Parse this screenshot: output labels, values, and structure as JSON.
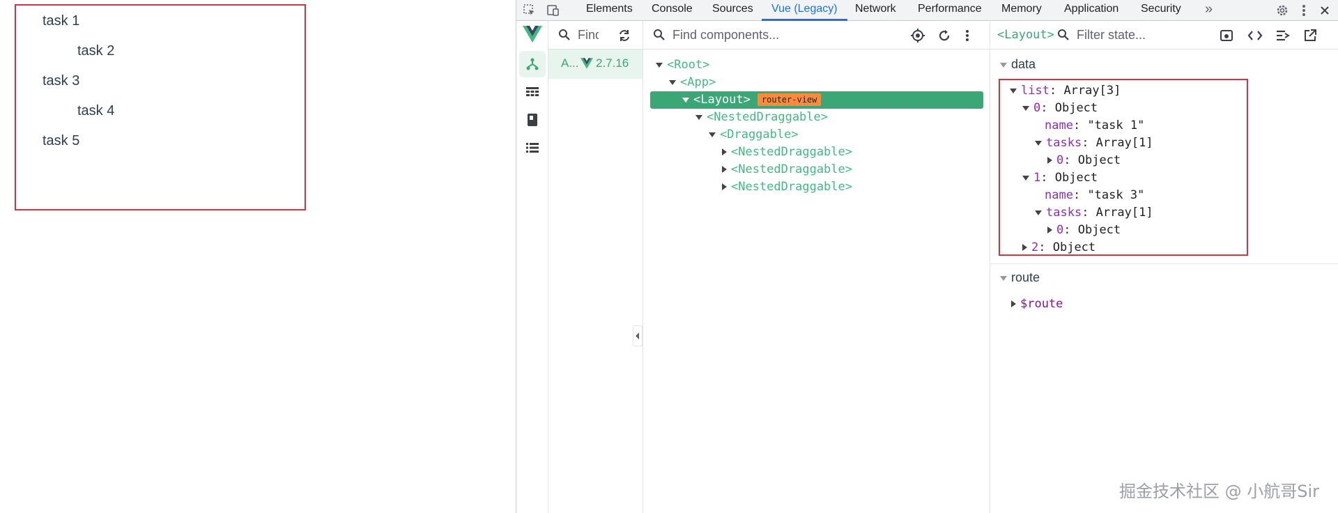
{
  "app": {
    "tasks": [
      "task 1",
      "task 2",
      "task 3",
      "task 4",
      "task 5"
    ]
  },
  "devtools": {
    "tabs": [
      "Elements",
      "Console",
      "Sources",
      "Vue (Legacy)",
      "Network",
      "Performance",
      "Memory",
      "Application",
      "Security"
    ],
    "active_tab": "Vue (Legacy)",
    "more_tabs": "»",
    "apps_search_placeholder": "Find apps...",
    "app_item": {
      "name": "A...",
      "version": "2.7.16"
    },
    "tree_search_placeholder": "Find components...",
    "tree": [
      {
        "label": "<Root>",
        "expanded": true,
        "depth": 0
      },
      {
        "label": "<App>",
        "expanded": true,
        "depth": 1
      },
      {
        "label": "<Layout>",
        "expanded": true,
        "depth": 2,
        "selected": true,
        "badge": "router-view"
      },
      {
        "label": "<NestedDraggable>",
        "expanded": true,
        "depth": 3
      },
      {
        "label": "<Draggable>",
        "expanded": true,
        "depth": 4
      },
      {
        "label": "<NestedDraggable>",
        "expanded": false,
        "depth": 5
      },
      {
        "label": "<NestedDraggable>",
        "expanded": false,
        "depth": 5
      },
      {
        "label": "<NestedDraggable>",
        "expanded": false,
        "depth": 5
      }
    ],
    "state": {
      "component": "<Layout>",
      "filter_placeholder": "Filter state...",
      "data_title": "data",
      "route_title": "route",
      "route_item": "$route",
      "rows": [
        {
          "key": "list",
          "sep": ": ",
          "value": "Array[3]",
          "depth": 0,
          "arrow": "down",
          "kind": "prop"
        },
        {
          "key": "0",
          "sep": ": ",
          "value": "Object",
          "depth": 1,
          "arrow": "down",
          "kind": "index"
        },
        {
          "key": "name",
          "sep": ": ",
          "value": "\"task 1\"",
          "depth": 2,
          "arrow": "none",
          "kind": "prop"
        },
        {
          "key": "tasks",
          "sep": ": ",
          "value": "Array[1]",
          "depth": 2,
          "arrow": "down",
          "kind": "prop"
        },
        {
          "key": "0",
          "sep": ": ",
          "value": "Object",
          "depth": 3,
          "arrow": "right",
          "kind": "index"
        },
        {
          "key": "1",
          "sep": ": ",
          "value": "Object",
          "depth": 1,
          "arrow": "down",
          "kind": "index"
        },
        {
          "key": "name",
          "sep": ": ",
          "value": "\"task 3\"",
          "depth": 2,
          "arrow": "none",
          "kind": "prop"
        },
        {
          "key": "tasks",
          "sep": ": ",
          "value": "Array[1]",
          "depth": 2,
          "arrow": "down",
          "kind": "prop"
        },
        {
          "key": "0",
          "sep": ": ",
          "value": "Object",
          "depth": 3,
          "arrow": "right",
          "kind": "index"
        },
        {
          "key": "2",
          "sep": ": ",
          "value": "Object",
          "depth": 1,
          "arrow": "right",
          "kind": "index"
        }
      ]
    }
  },
  "watermark": "掘金技术社区 @ 小航哥Sir",
  "colors": {
    "vue_green": "#42b983",
    "selected_row": "#3ba776",
    "badge": "#ff8a3a",
    "highlight_border": "#d1343e",
    "devtools_blue": "#1a73e8"
  }
}
